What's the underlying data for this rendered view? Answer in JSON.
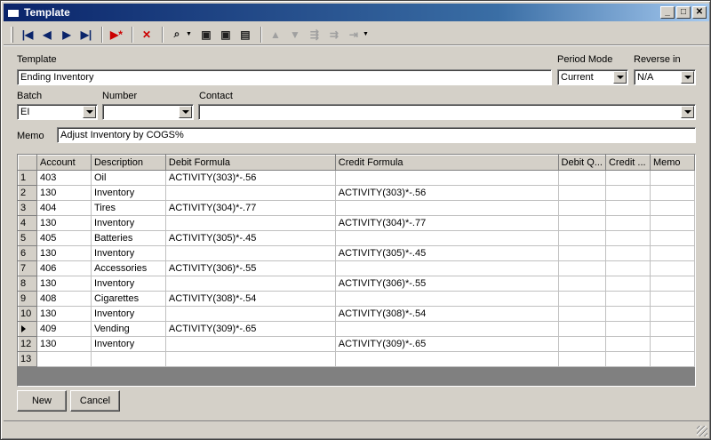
{
  "window": {
    "title": "Template"
  },
  "form": {
    "template_label": "Template",
    "template_value": "Ending Inventory",
    "period_mode_label": "Period Mode",
    "period_mode_value": "Current",
    "reverse_in_label": "Reverse in",
    "reverse_in_value": "N/A",
    "batch_label": "Batch",
    "batch_value": "EI",
    "number_label": "Number",
    "number_value": "",
    "contact_label": "Contact",
    "contact_value": "",
    "memo_label": "Memo",
    "memo_value": "Adjust Inventory by COGS%"
  },
  "grid": {
    "columns": [
      "Account",
      "Description",
      "Debit Formula",
      "Credit Formula",
      "Debit Q...",
      "Credit ...",
      "Memo"
    ],
    "current_row": 11,
    "rows": [
      {
        "num": "1",
        "account": "403",
        "description": "Oil",
        "debit_formula": "ACTIVITY(303)*-.56",
        "credit_formula": ""
      },
      {
        "num": "2",
        "account": "130",
        "description": "Inventory",
        "debit_formula": "",
        "credit_formula": "ACTIVITY(303)*-.56"
      },
      {
        "num": "3",
        "account": "404",
        "description": "Tires",
        "debit_formula": "ACTIVITY(304)*-.77",
        "credit_formula": ""
      },
      {
        "num": "4",
        "account": "130",
        "description": "Inventory",
        "debit_formula": "",
        "credit_formula": "ACTIVITY(304)*-.77"
      },
      {
        "num": "5",
        "account": "405",
        "description": "Batteries",
        "debit_formula": "ACTIVITY(305)*-.45",
        "credit_formula": ""
      },
      {
        "num": "6",
        "account": "130",
        "description": "Inventory",
        "debit_formula": "",
        "credit_formula": "ACTIVITY(305)*-.45"
      },
      {
        "num": "7",
        "account": "406",
        "description": "Accessories",
        "debit_formula": "ACTIVITY(306)*-.55",
        "credit_formula": ""
      },
      {
        "num": "8",
        "account": "130",
        "description": "Inventory",
        "debit_formula": "",
        "credit_formula": "ACTIVITY(306)*-.55"
      },
      {
        "num": "9",
        "account": "408",
        "description": "Cigarettes",
        "debit_formula": "ACTIVITY(308)*-.54",
        "credit_formula": ""
      },
      {
        "num": "10",
        "account": "130",
        "description": "Inventory",
        "debit_formula": "",
        "credit_formula": "ACTIVITY(308)*-.54"
      },
      {
        "num": "",
        "account": "409",
        "description": "Vending",
        "debit_formula": "ACTIVITY(309)*-.65",
        "credit_formula": ""
      },
      {
        "num": "12",
        "account": "130",
        "description": "Inventory",
        "debit_formula": "",
        "credit_formula": "ACTIVITY(309)*-.65"
      },
      {
        "num": "13",
        "account": "",
        "description": "",
        "debit_formula": "",
        "credit_formula": ""
      }
    ]
  },
  "buttons": {
    "new_label": "New",
    "cancel_label": "Cancel"
  },
  "toolbar_icons": [
    "first-record-icon",
    "previous-record-icon",
    "next-record-icon",
    "last-record-icon",
    "new-record-icon",
    "delete-icon",
    "find-icon",
    "save-icon",
    "save-close-icon",
    "properties-icon",
    "move-up-icon",
    "move-down-icon",
    "insert-row-icon",
    "insert-column-icon",
    "outdent-icon"
  ]
}
